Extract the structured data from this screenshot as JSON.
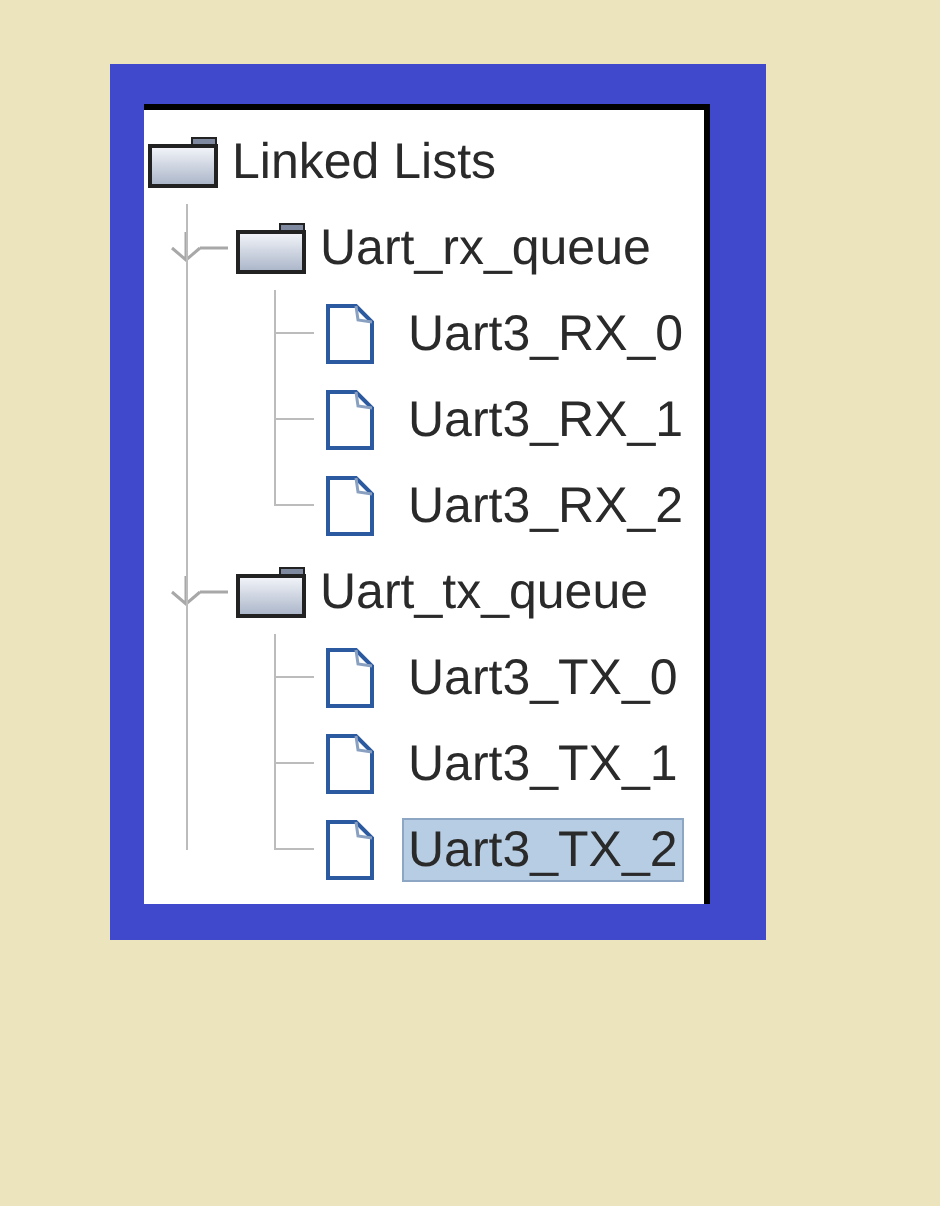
{
  "tree": {
    "label": "Linked Lists",
    "kind": "folder",
    "selected": false,
    "children": [
      {
        "label": "Uart_rx_queue",
        "kind": "folder",
        "expanded": true,
        "selected": false,
        "children": [
          {
            "label": "Uart3_RX_0",
            "kind": "file",
            "selected": false
          },
          {
            "label": "Uart3_RX_1",
            "kind": "file",
            "selected": false
          },
          {
            "label": "Uart3_RX_2",
            "kind": "file",
            "selected": false
          }
        ]
      },
      {
        "label": "Uart_tx_queue",
        "kind": "folder",
        "expanded": true,
        "selected": false,
        "children": [
          {
            "label": "Uart3_TX_0",
            "kind": "file",
            "selected": false
          },
          {
            "label": "Uart3_TX_1",
            "kind": "file",
            "selected": false
          },
          {
            "label": "Uart3_TX_2",
            "kind": "file",
            "selected": true
          }
        ]
      }
    ]
  }
}
